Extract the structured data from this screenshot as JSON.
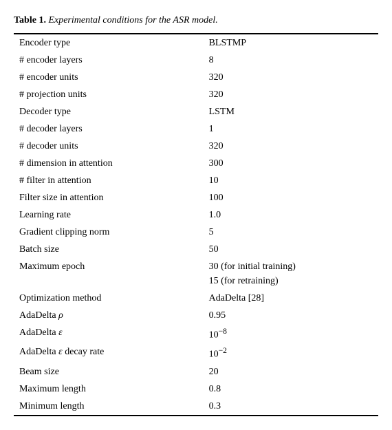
{
  "caption": {
    "prefix": "Table 1.",
    "text": " Experimental conditions for the ASR model."
  },
  "table": {
    "rows": [
      {
        "param": "Encoder type",
        "value": "BLSTMP",
        "value2": null
      },
      {
        "param": "# encoder layers",
        "value": "8",
        "value2": null
      },
      {
        "param": "# encoder units",
        "value": "320",
        "value2": null
      },
      {
        "param": "# projection units",
        "value": "320",
        "value2": null
      },
      {
        "param": "Decoder type",
        "value": "LSTM",
        "value2": null
      },
      {
        "param": "# decoder layers",
        "value": "1",
        "value2": null
      },
      {
        "param": "# decoder units",
        "value": "320",
        "value2": null
      },
      {
        "param": "# dimension in attention",
        "value": "300",
        "value2": null
      },
      {
        "param": "# filter in attention",
        "value": "10",
        "value2": null
      },
      {
        "param": "Filter size in attention",
        "value": "100",
        "value2": null
      },
      {
        "param": "Learning rate",
        "value": "1.0",
        "value2": null
      },
      {
        "param": "Gradient clipping norm",
        "value": "5",
        "value2": null
      },
      {
        "param": "Batch size",
        "value": "50",
        "value2": null
      },
      {
        "param": "Maximum epoch",
        "value": "30 (for initial training)",
        "value2": "15 (for retraining)"
      },
      {
        "param": "Optimization method",
        "value": "AdaDelta [28]",
        "value2": null
      },
      {
        "param": "AdaDelta ρ",
        "value": "0.95",
        "value2": null
      },
      {
        "param": "AdaDelta ε",
        "value": "10⁻⁸",
        "value2": null
      },
      {
        "param": "AdaDelta ε decay rate",
        "value": "10⁻²",
        "value2": null
      },
      {
        "param": "Beam size",
        "value": "20",
        "value2": null
      },
      {
        "param": "Maximum length",
        "value": "0.8",
        "value2": null
      },
      {
        "param": "Minimum length",
        "value": "0.3",
        "value2": null
      }
    ]
  }
}
